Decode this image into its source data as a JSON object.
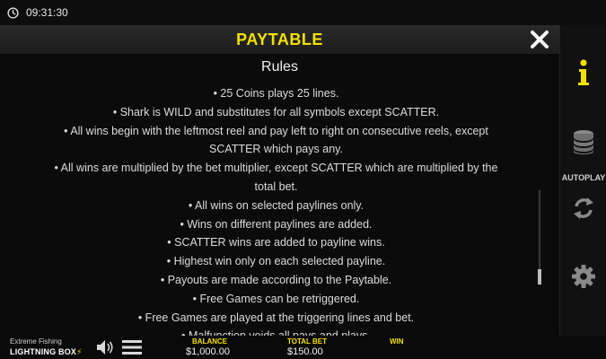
{
  "topbar": {
    "time": "09:31:30",
    "clock_icon": "clock-icon"
  },
  "paytable": {
    "title": "PAYTABLE",
    "section_title": "Rules",
    "rules": [
      "• 25 Coins plays 25 lines.",
      "• Shark is WILD and substitutes for all symbols except SCATTER.",
      "• All wins begin with the leftmost reel and pay left to right on consecutive reels, except",
      "SCATTER which pays any.",
      "• All wins are multiplied by the bet multiplier, except SCATTER which are multiplied by the",
      "total bet.",
      "• All wins on selected paylines only.",
      "• Wins on different paylines are added.",
      "• SCATTER wins are added to payline wins.",
      "• Highest win only on each selected payline.",
      "• Payouts are made according to the Paytable.",
      "• Free Games can be retriggered.",
      "• Free Games are played at the triggering lines and bet.",
      "• Malfunction voids all pays and plays."
    ]
  },
  "sidebar": {
    "autoplay_label": "AUTOPLAY"
  },
  "bottombar": {
    "game_name": "Extreme Fishing",
    "brand": "LIGHTNING BOX",
    "balance_label": "BALANCE",
    "balance_value": "$1,000.00",
    "total_bet_label": "TOTAL BET",
    "total_bet_value": "$150.00",
    "win_label": "WIN",
    "win_value": ""
  },
  "colors": {
    "accent": "#f2e100",
    "background": "#000000",
    "panel": "#0b0b0b",
    "header": "#242424"
  }
}
